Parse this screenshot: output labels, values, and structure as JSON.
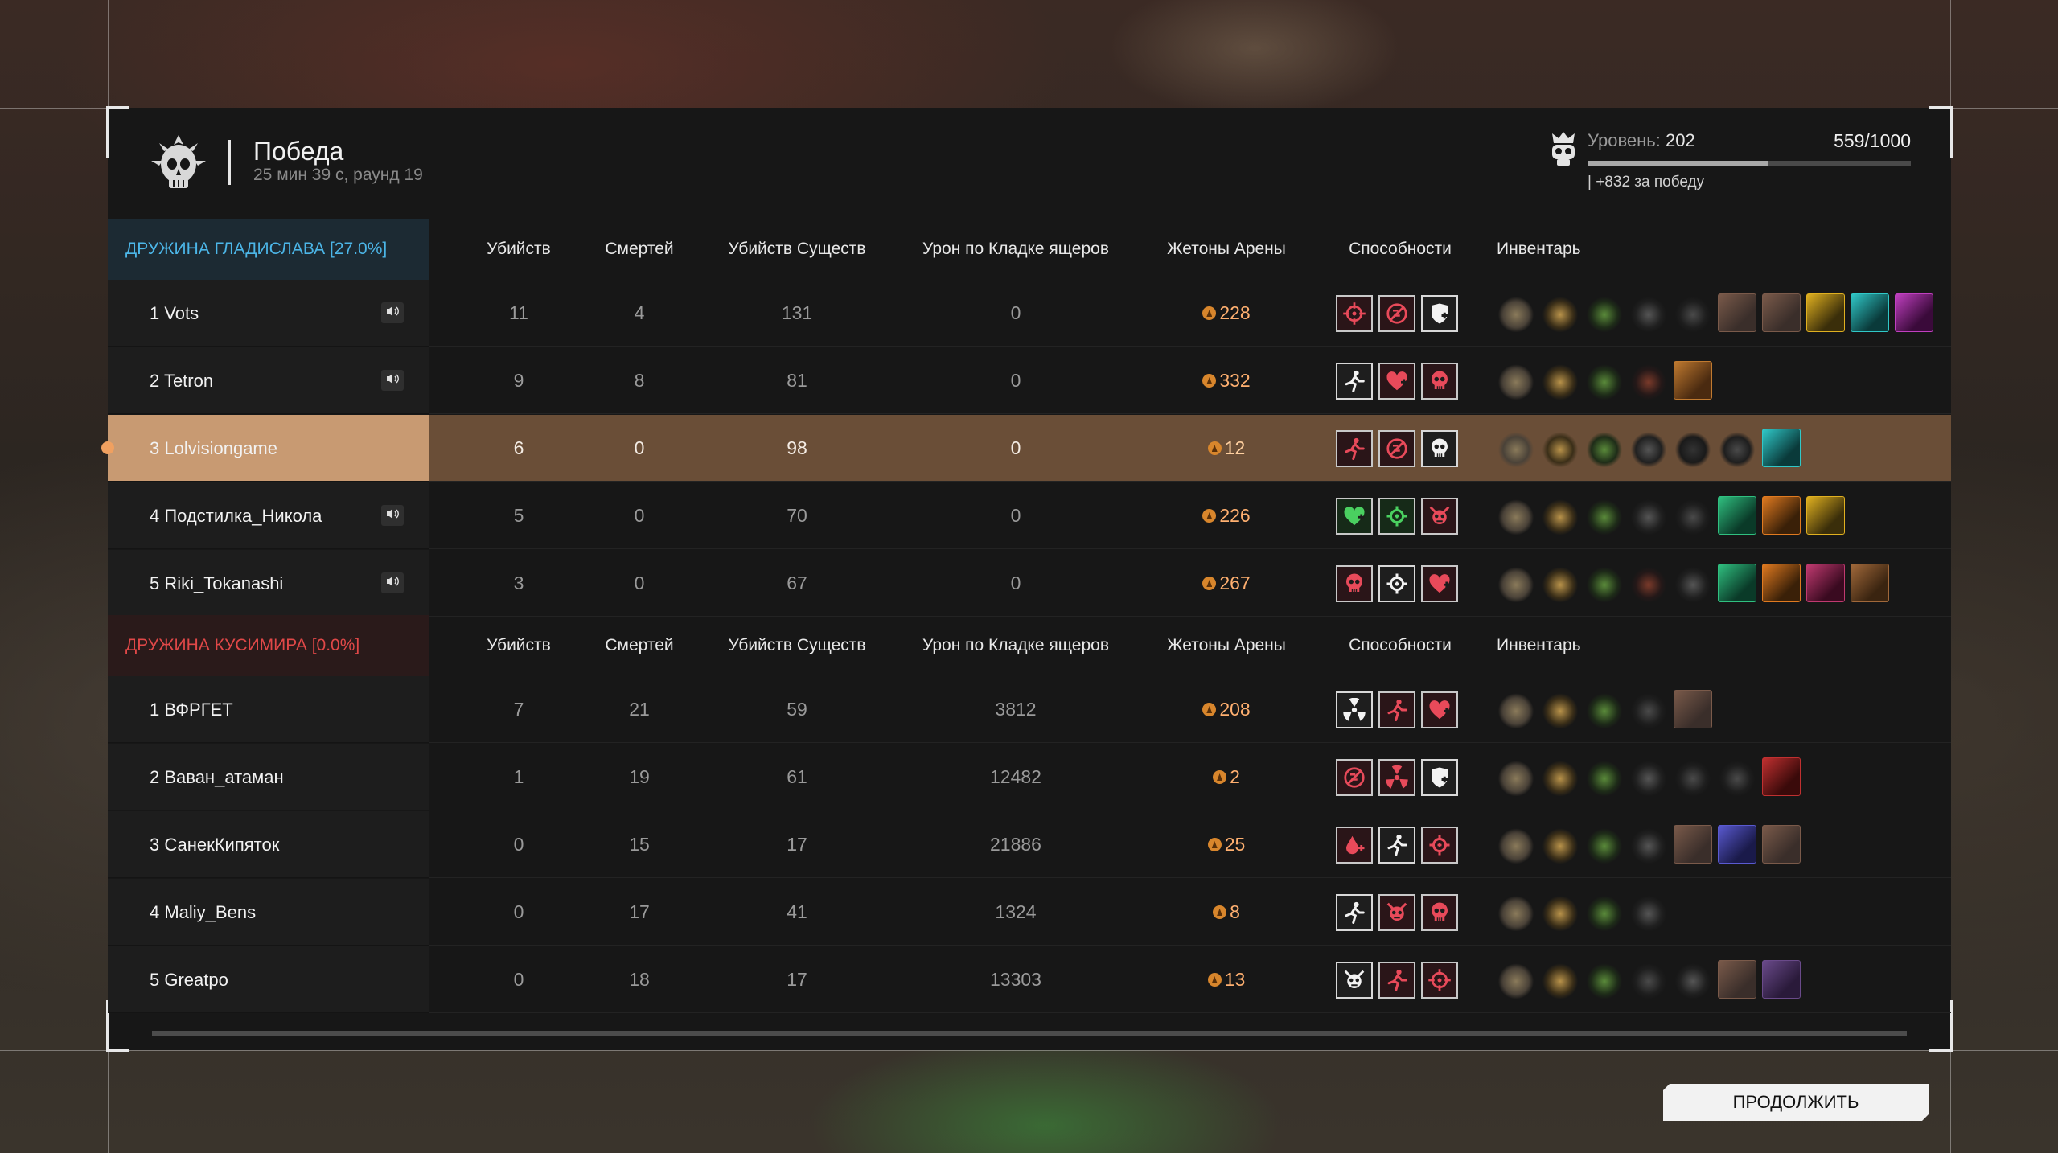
{
  "header": {
    "title": "Победа",
    "subtitle": "25 мин 39 с, раунд 19",
    "level_label": "Уровень:",
    "level_value": "202",
    "xp_text": "559/1000",
    "xp_progress": 0.559,
    "bonus": "| +832 за победу"
  },
  "columns": {
    "kills": "Убийств",
    "deaths": "Смертей",
    "creature_kills": "Убийств Существ",
    "lizard_damage": "Урон по Кладке ящеров",
    "arena_tokens": "Жетоны Арены",
    "abilities": "Способности",
    "inventory": "Инвентарь"
  },
  "teams": [
    {
      "name": "ДРУЖИНА ГЛАДИСЛАВА [27.0%]",
      "color": "#4cb6e8",
      "players": [
        {
          "name": "1 Vots",
          "speaker": true,
          "kills": "11",
          "deaths": "4",
          "creatures": "131",
          "damage": "0",
          "tokens": "228",
          "abilities": [
            "crosshair-icon",
            "no-heal-icon",
            "shield-plus-icon"
          ],
          "ability_styles": [
            "r",
            "r",
            "w"
          ],
          "inventory": [
            "armor",
            "ammo",
            "grenade",
            "rifle",
            "knife",
            "portrait",
            "portrait",
            "tome-gold",
            "blade-teal",
            "hat-purple"
          ]
        },
        {
          "name": "2 Tetron",
          "speaker": true,
          "kills": "9",
          "deaths": "8",
          "creatures": "81",
          "damage": "0",
          "tokens": "332",
          "abilities": [
            "runner-icon",
            "heart-plus-icon",
            "skull-icon"
          ],
          "ability_styles": [
            "w",
            "r",
            "r"
          ],
          "inventory": [
            "armor",
            "ammo",
            "grenade",
            "spear",
            "boots"
          ]
        },
        {
          "name": "3 Lolvisiongame",
          "speaker": false,
          "highlight": true,
          "kills": "6",
          "deaths": "0",
          "creatures": "98",
          "damage": "0",
          "tokens": "12",
          "abilities": [
            "runner-icon",
            "no-heal-icon",
            "skull-icon"
          ],
          "ability_styles": [
            "r",
            "r",
            "w"
          ],
          "inventory": [
            "armor",
            "ammo",
            "grenade",
            "rifle",
            "pistol",
            "knife",
            "blade-teal"
          ]
        },
        {
          "name": "4 Подстилка_Никола",
          "speaker": true,
          "kills": "5",
          "deaths": "0",
          "creatures": "70",
          "damage": "0",
          "tokens": "226",
          "abilities": [
            "heart-plus-icon",
            "target-icon",
            "demon-icon"
          ],
          "ability_styles": [
            "g",
            "g",
            "r"
          ],
          "inventory": [
            "armor",
            "ammo",
            "grenade",
            "rifle",
            "knife",
            "whip-green",
            "claws-orange",
            "tome-gold"
          ]
        },
        {
          "name": "5 Riki_Tokanashi",
          "speaker": true,
          "kills": "3",
          "deaths": "0",
          "creatures": "67",
          "damage": "0",
          "tokens": "267",
          "abilities": [
            "skull-icon",
            "target-icon",
            "heart-plus-icon"
          ],
          "ability_styles": [
            "r",
            "w",
            "r"
          ],
          "inventory": [
            "armor",
            "ammo",
            "grenade",
            "spear",
            "rifle",
            "whip-green",
            "claws-orange",
            "chest-pink",
            "case-brown"
          ]
        }
      ]
    },
    {
      "name": "ДРУЖИНА КУСИМИРА [0.0%]",
      "color": "#e04848",
      "players": [
        {
          "name": "1 ВФРГЕТ",
          "speaker": false,
          "kills": "7",
          "deaths": "21",
          "creatures": "59",
          "damage": "3812",
          "tokens": "208",
          "abilities": [
            "radiation-icon",
            "runner-icon",
            "heart-plus-icon"
          ],
          "ability_styles": [
            "w",
            "r",
            "r"
          ],
          "inventory": [
            "armor",
            "ammo",
            "grenade",
            "knife",
            "portrait"
          ]
        },
        {
          "name": "2 Ваван_атаман",
          "speaker": false,
          "kills": "1",
          "deaths": "19",
          "creatures": "61",
          "damage": "12482",
          "tokens": "2",
          "abilities": [
            "no-heal-icon",
            "radiation-icon",
            "shield-plus-icon"
          ],
          "ability_styles": [
            "r",
            "r",
            "w"
          ],
          "inventory": [
            "armor",
            "ammo",
            "grenade",
            "rifle",
            "knife",
            "knife",
            "blade-red"
          ]
        },
        {
          "name": "3 СанекКипяток",
          "speaker": false,
          "kills": "0",
          "deaths": "15",
          "creatures": "17",
          "damage": "21886",
          "tokens": "25",
          "abilities": [
            "blood-icon",
            "runner-icon",
            "target-icon"
          ],
          "ability_styles": [
            "r",
            "w",
            "r"
          ],
          "inventory": [
            "armor",
            "ammo",
            "grenade",
            "rifle",
            "portrait",
            "blade-blue",
            "portrait"
          ]
        },
        {
          "name": "4 Maliy_Bens",
          "speaker": false,
          "kills": "0",
          "deaths": "17",
          "creatures": "41",
          "damage": "1324",
          "tokens": "8",
          "abilities": [
            "runner-icon",
            "demon-icon",
            "skull-icon"
          ],
          "ability_styles": [
            "w",
            "r",
            "r"
          ],
          "inventory": [
            "armor",
            "ammo",
            "grenade",
            "rifle"
          ]
        },
        {
          "name": "5 Greatpo",
          "speaker": false,
          "kills": "0",
          "deaths": "18",
          "creatures": "17",
          "damage": "13303",
          "tokens": "13",
          "abilities": [
            "demon-icon",
            "runner-icon",
            "crosshair-icon"
          ],
          "ability_styles": [
            "w",
            "r",
            "r"
          ],
          "inventory": [
            "armor",
            "ammo",
            "grenade",
            "knife",
            "rifle",
            "portrait",
            "blade-purple"
          ]
        }
      ]
    }
  ],
  "continue_label": "ПРОДОЛЖИТЬ"
}
